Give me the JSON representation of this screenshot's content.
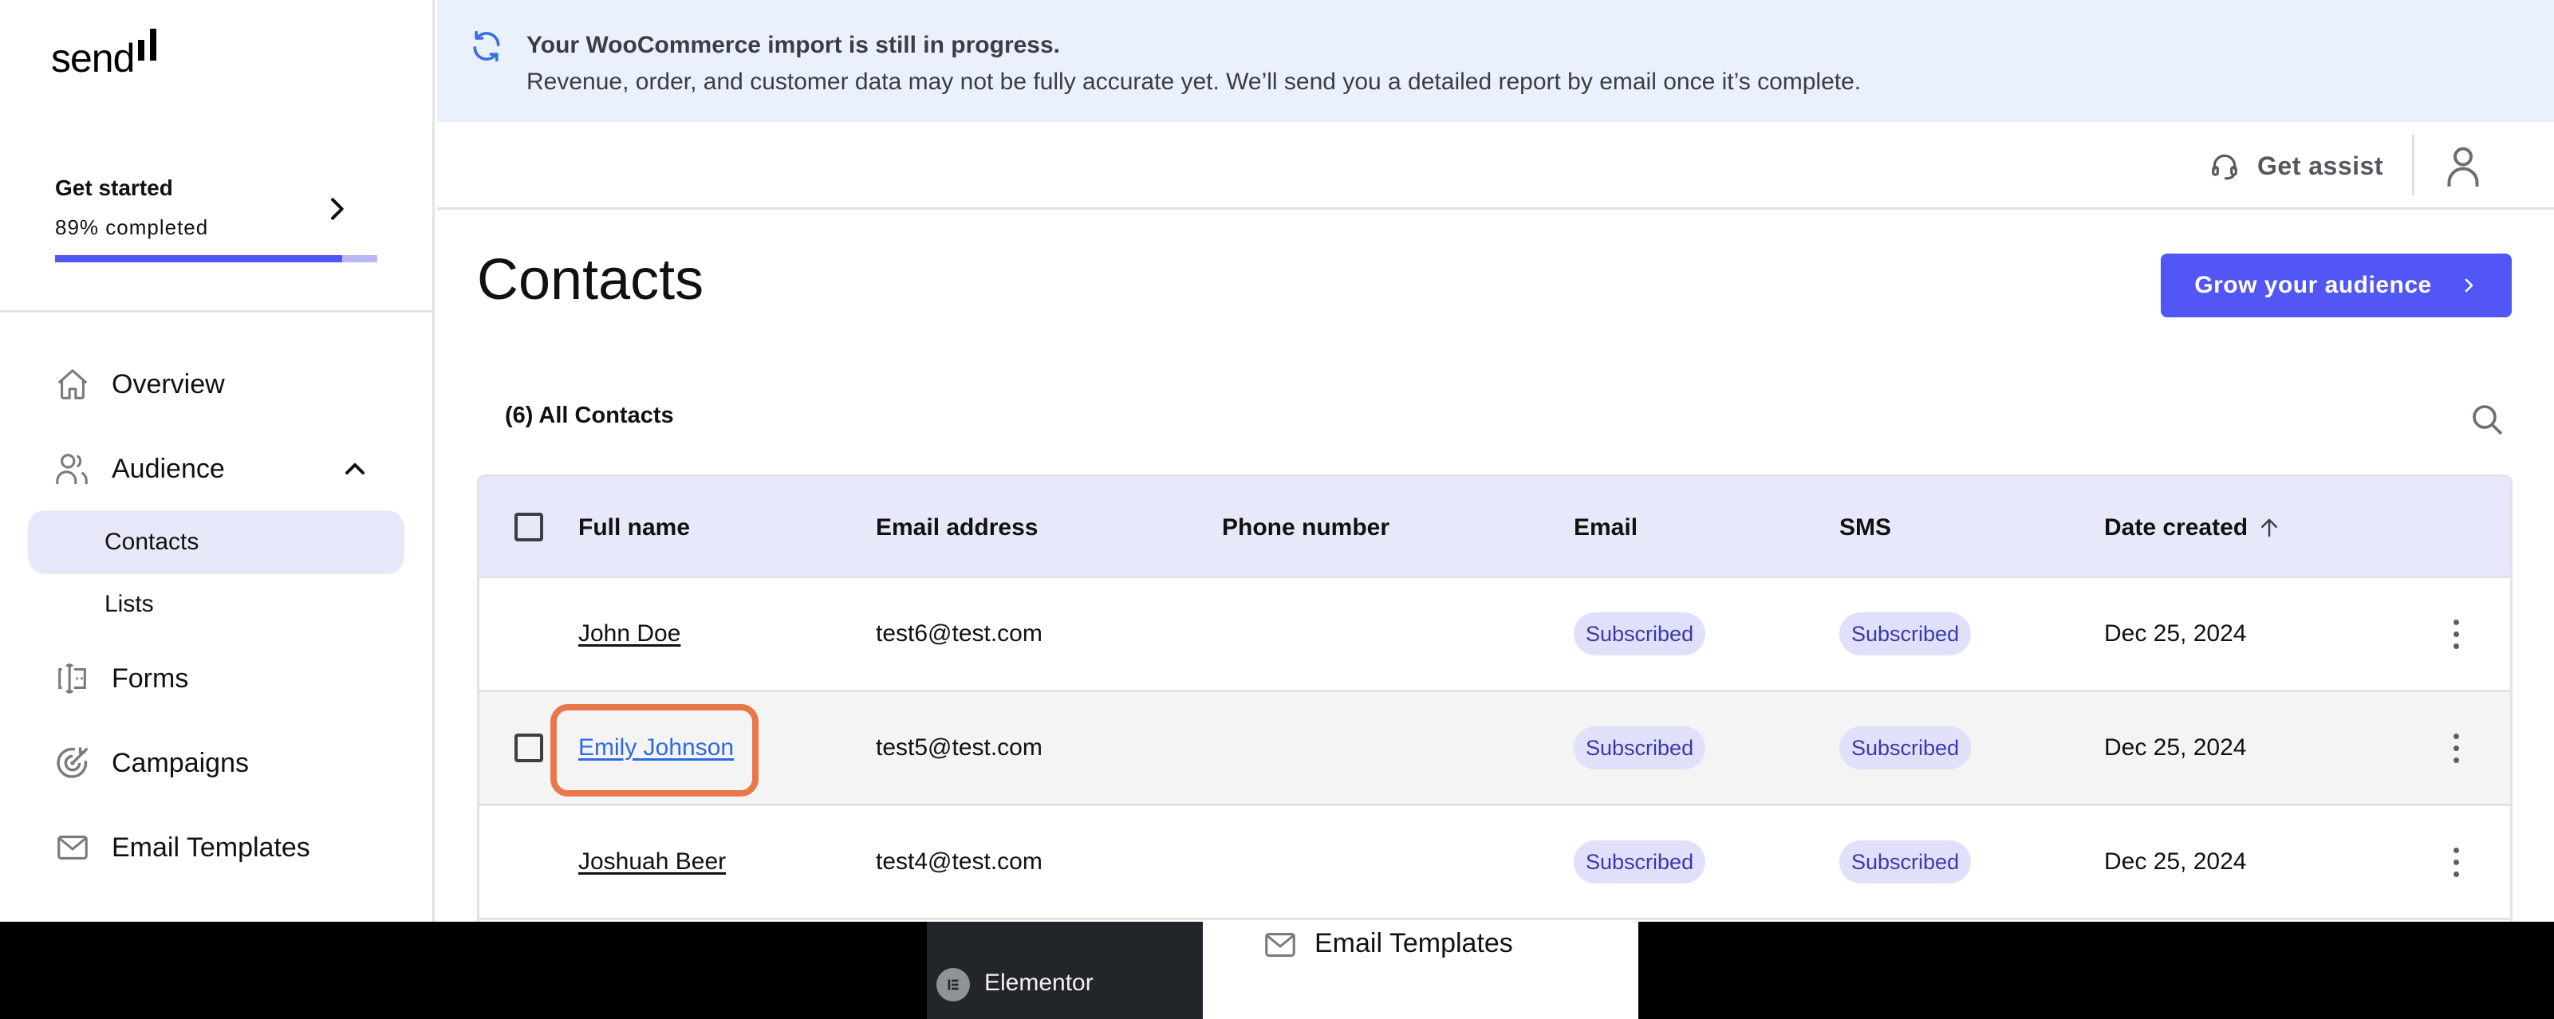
{
  "brand": {
    "logo_text": "send"
  },
  "get_started": {
    "title": "Get started",
    "progress_text": "89% completed",
    "progress_fraction": 0.89
  },
  "sidebar": {
    "items": [
      {
        "label": "Overview",
        "icon": "home-icon"
      },
      {
        "label": "Audience",
        "icon": "users-icon",
        "expanded": true,
        "children": [
          {
            "label": "Contacts",
            "active": true
          },
          {
            "label": "Lists",
            "active": false
          }
        ]
      },
      {
        "label": "Forms",
        "icon": "form-icon"
      },
      {
        "label": "Campaigns",
        "icon": "target-icon"
      },
      {
        "label": "Email Templates",
        "icon": "mail-icon"
      }
    ]
  },
  "banner": {
    "icon": "sync-icon",
    "title": "Your WooCommerce import is still in progress.",
    "text": "Revenue, order, and customer data may not be fully accurate yet. We’ll send you a detailed report by email once it’s complete."
  },
  "topbar": {
    "assist_label": "Get assist"
  },
  "page": {
    "title": "Contacts",
    "primary_button": "Grow your audience",
    "count_label": "(6) All Contacts"
  },
  "table": {
    "columns": [
      "Full name",
      "Email address",
      "Phone number",
      "Email",
      "SMS",
      "Date created"
    ],
    "sort": {
      "column": "Date created",
      "direction": "ascending"
    },
    "rows": [
      {
        "name": "John Doe",
        "email": "test6@test.com",
        "phone": "",
        "email_status": "Subscribed",
        "sms_status": "Subscribed",
        "date": "Dec 25, 2024"
      },
      {
        "name": "Emily Johnson",
        "email": "test5@test.com",
        "phone": "",
        "email_status": "Subscribed",
        "sms_status": "Subscribed",
        "date": "Dec 25, 2024",
        "hovered": true
      },
      {
        "name": "Joshuah Beer",
        "email": "test4@test.com",
        "phone": "",
        "email_status": "Subscribed",
        "sms_status": "Subscribed",
        "date": "Dec 25, 2024"
      }
    ]
  },
  "dock": {
    "items": [
      {
        "label": "Elementor"
      },
      {
        "label": "Email Templates"
      }
    ]
  },
  "colors": {
    "accent": "#5156f4",
    "banner_bg": "#eaf0fc",
    "header_bg": "#e8e8fb",
    "badge_bg": "#e0e0fb",
    "badge_text": "#3a3aa8",
    "highlight": "#e8784a",
    "link_active": "#2f6ae0"
  }
}
